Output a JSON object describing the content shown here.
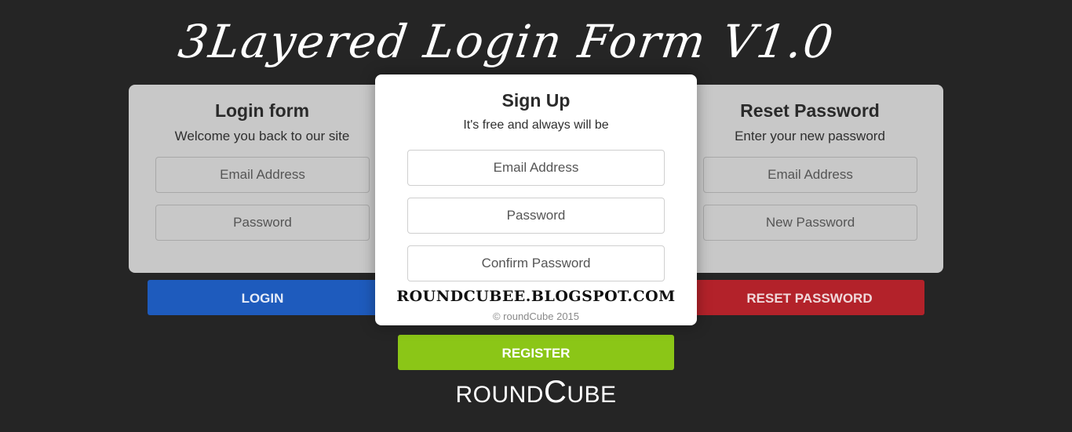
{
  "page_title": "3Layered Login Form V1.0",
  "login_panel": {
    "title": "Login form",
    "subtitle": "Welcome you back to our site",
    "email_placeholder": "Email Address",
    "password_placeholder": "Password",
    "button_label": "LOGIN"
  },
  "signup_panel": {
    "title": "Sign Up",
    "subtitle": "It's free and always will be",
    "email_placeholder": "Email Address",
    "password_placeholder": "Password",
    "confirm_placeholder": "Confirm Password",
    "blog_text": "ROUNDCUBEE.BLOGSPOT.COM",
    "copyright": "© roundCube 2015",
    "button_label": "REGISTER"
  },
  "reset_panel": {
    "title": "Reset Password",
    "subtitle": "Enter your new password",
    "email_placeholder": "Email Address",
    "new_password_placeholder": "New Password",
    "button_label": "RESET PASSWORD"
  },
  "brand": {
    "prefix": "ROUND",
    "big_letter": "C",
    "suffix": "UBE"
  },
  "colors": {
    "background": "#252525",
    "side_panel": "#c8c8c8",
    "login_button": "#1e5bbd",
    "reset_button": "#b3222a",
    "register_button": "#8bc617"
  }
}
